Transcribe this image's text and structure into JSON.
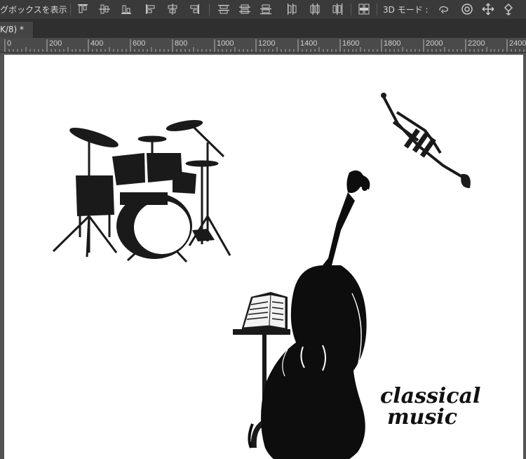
{
  "options_bar": {
    "show_bounding_box_label": "グボックスを表示",
    "mode_3d_label": "3D モード :",
    "align_icons": [
      "align-top-edges-icon",
      "align-vertical-centers-icon",
      "align-bottom-edges-icon",
      "align-left-edges-icon",
      "align-horizontal-centers-icon",
      "align-right-edges-icon"
    ],
    "distribute_icons": [
      "distribute-top-icon",
      "distribute-vertical-centers-icon",
      "distribute-bottom-icon",
      "distribute-left-icon",
      "distribute-horizontal-centers-icon",
      "distribute-right-icon",
      "auto-align-layers-icon"
    ],
    "mode_3d_icons": [
      "rotate-3d-icon",
      "roll-3d-icon",
      "pan-3d-icon",
      "slide-3d-icon"
    ]
  },
  "document_tab": {
    "label": "K/8) *"
  },
  "ruler": {
    "labels": [
      "0",
      "200",
      "400",
      "600",
      "800",
      "1000",
      "1200",
      "1400",
      "1600",
      "1800",
      "2000",
      "2200",
      "2400"
    ]
  },
  "artwork": {
    "caption_line1": "classical",
    "caption_line2": "music",
    "elements": [
      "drum-kit",
      "trumpet",
      "cello",
      "music-stand"
    ]
  }
}
